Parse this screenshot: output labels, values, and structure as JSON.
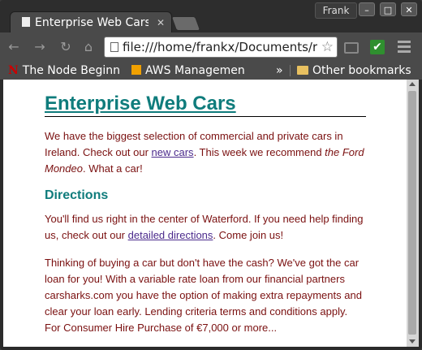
{
  "window": {
    "tab_title": "Enterprise Web Cars",
    "user": "Frank"
  },
  "toolbar": {
    "url": "file:///home/frankx/Documents/r"
  },
  "bookmarks": {
    "items": [
      {
        "label": "The Node Beginn"
      },
      {
        "label": "AWS Managemen"
      }
    ],
    "overflow": "»",
    "other": "Other bookmarks"
  },
  "page": {
    "heading": "Enterprise Web Cars",
    "intro_1": "We have the biggest selection of commercial and private cars in Ireland. Check out our ",
    "intro_link": "new cars",
    "intro_2": ". This week we recommend ",
    "intro_em": "the Ford Mondeo",
    "intro_3": ". What a car!",
    "directions_heading": "Directions",
    "dir_1": "You'll find us right in the center of Waterford. If you need help finding us, check out our ",
    "dir_link": "detailed directions",
    "dir_2": ". Come join us!",
    "loan_text": "Thinking of buying a car but don't have the cash? We've got the car loan for you! With a variable rate loan from our financial partners carsharks.com you have the option of making extra repayments and clear your loan early. Lending criteria terms and conditions apply. For Consumer Hire Purchase of €7,000 or more..."
  }
}
